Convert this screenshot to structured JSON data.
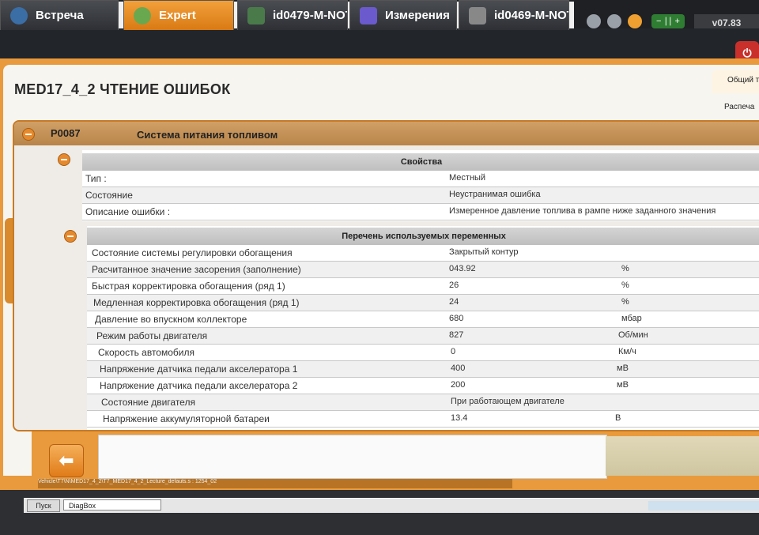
{
  "topbar": {
    "version": "v07.83",
    "battery": "− ∣∣ +"
  },
  "tabs": [
    {
      "label": "Встреча",
      "color": "#3a6ea5"
    },
    {
      "label": "Expert",
      "color": "#6aa84f"
    },
    {
      "label": "id0479-M-NOT...",
      "color": "#4a7a4a"
    },
    {
      "label": "Измерения",
      "color": "#6a5acd"
    },
    {
      "label": "id0469-M-NOT...",
      "color": "#888888"
    }
  ],
  "page_title": "MED17_4_2  ЧТЕНИЕ ОШИБОК",
  "right_tabs": [
    "Общий т",
    "Распеча"
  ],
  "fault": {
    "code": "P0087",
    "description": "Система питания топливом"
  },
  "properties": {
    "header": "Свойства",
    "rows": [
      {
        "label": "Тип :",
        "value": "Местный"
      },
      {
        "label": "Состояние",
        "value": "Неустранимая ошибка"
      },
      {
        "label": "Описание ошибки :",
        "value": "Измеренное давление топлива в рампе ниже заданного значения"
      }
    ]
  },
  "variables": {
    "header": "Перечень используемых переменных",
    "rows": [
      {
        "label": "Состояние системы регулировки обогащения",
        "value": "Закрытый контур",
        "unit": ""
      },
      {
        "label": "Расчитанное значение засорения (заполнение)",
        "value": "043.92",
        "unit": "%"
      },
      {
        "label": "Быстрая корректировка обогащения (ряд 1)",
        "value": "26",
        "unit": "%"
      },
      {
        "label": "Медленная корректировка обогащения (ряд 1)",
        "value": "24",
        "unit": "%"
      },
      {
        "label": "Давление во впускном коллекторе",
        "value": "680",
        "unit": "мбар"
      },
      {
        "label": "Режим работы двигателя",
        "value": "827",
        "unit": "Об/мин"
      },
      {
        "label": "Скорость автомобиля",
        "value": "0",
        "unit": "Км/ч"
      },
      {
        "label": "Напряжение датчика педали акселератора 1",
        "value": "400",
        "unit": "мВ"
      },
      {
        "label": "Напряжение датчика педали акселератора 2",
        "value": "200",
        "unit": "мВ"
      },
      {
        "label": "Состояние двигателя",
        "value": "При работающем двигателе",
        "unit": ""
      },
      {
        "label": "Напряжение аккумуляторной батареи",
        "value": "13.4",
        "unit": "В"
      }
    ]
  },
  "status_path": "Vehicle\\T7\\N\\MED17_4_2\\T7_MED17_4_2_Lecture_defauts.s : 1254_02",
  "taskbar": {
    "start": "Пуск",
    "app": "DiagBox"
  }
}
